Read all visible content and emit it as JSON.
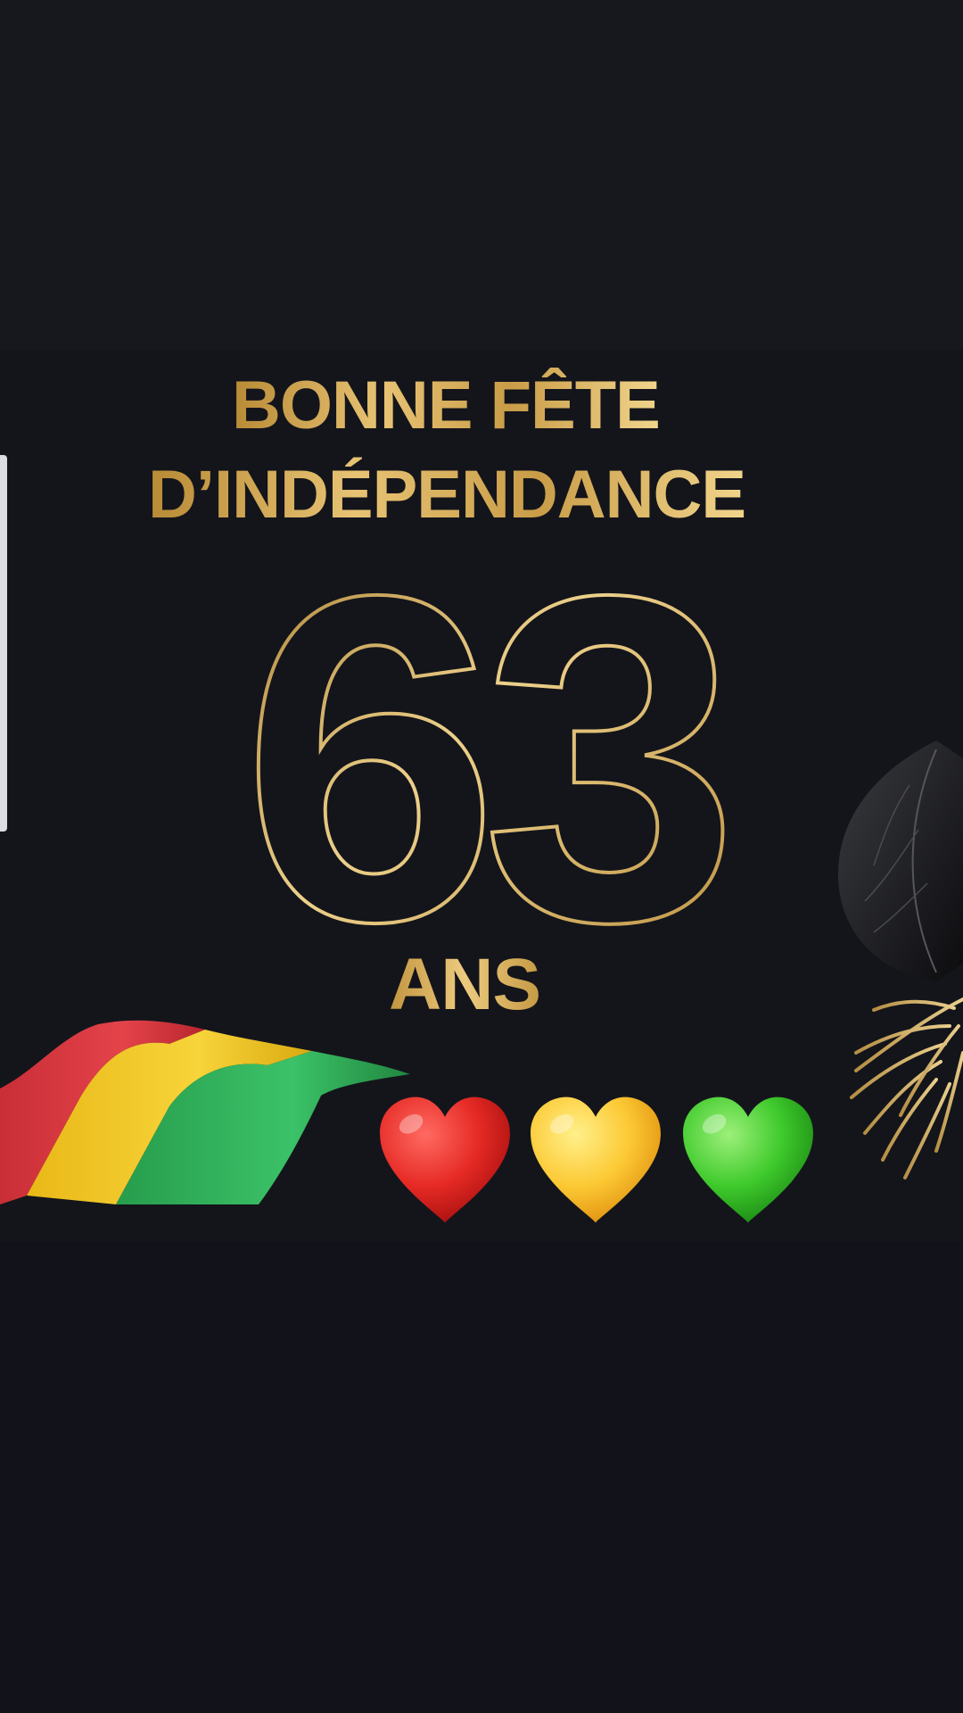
{
  "greeting": {
    "line1": "BONNE FÊTE",
    "line2": "D’INDÉPENDANCE",
    "number": "63",
    "unit": "ANS"
  },
  "colors": {
    "gold": "#c9a24e",
    "background": "#14151b",
    "flag_red": "#d9363e",
    "flag_yellow": "#f2c51b",
    "flag_green": "#2fb25a"
  },
  "icons": {
    "flag": "flag-icon",
    "foliage": "leaf-icon",
    "hearts": [
      "red-heart-icon",
      "yellow-heart-icon",
      "green-heart-icon"
    ]
  }
}
